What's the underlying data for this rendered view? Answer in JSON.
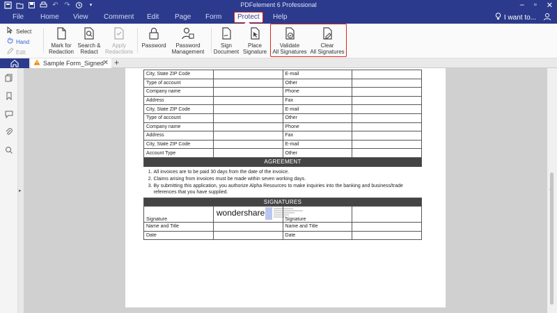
{
  "app": {
    "title": "PDFelement 6 Professional",
    "tell_me": "I want to..."
  },
  "menu": {
    "tabs": [
      "File",
      "Home",
      "View",
      "Comment",
      "Edit",
      "Page",
      "Form",
      "Protect",
      "Help"
    ],
    "active": "Protect"
  },
  "ribbon": {
    "tools": [
      {
        "label": "Select",
        "state": "normal"
      },
      {
        "label": "Hand",
        "state": "active"
      },
      {
        "label": "Edit",
        "state": "disabled"
      }
    ],
    "buttons": [
      {
        "l1": "Mark for",
        "l2": "Redaction",
        "icon": "redaction-mark-icon",
        "disabled": false
      },
      {
        "l1": "Search &",
        "l2": "Redact",
        "icon": "search-redact-icon",
        "disabled": false
      },
      {
        "l1": "Apply",
        "l2": "Redactions",
        "icon": "apply-redactions-icon",
        "disabled": true
      },
      {
        "l1": "Password",
        "l2": "",
        "icon": "lock-icon",
        "disabled": false
      },
      {
        "l1": "Password",
        "l2": "Management",
        "icon": "password-management-icon",
        "disabled": false
      },
      {
        "l1": "Sign",
        "l2": "Document",
        "icon": "sign-document-icon",
        "disabled": false
      },
      {
        "l1": "Place",
        "l2": "Signature",
        "icon": "place-signature-icon",
        "disabled": false
      },
      {
        "l1": "Validate",
        "l2": "All Signatures",
        "icon": "validate-signatures-icon",
        "disabled": false
      },
      {
        "l1": "Clear",
        "l2": "All Signatures",
        "icon": "clear-signatures-icon",
        "disabled": false
      }
    ]
  },
  "document": {
    "tab_name": "Sample Form_Signed"
  },
  "form": {
    "rows": [
      [
        "City, State ZIP Code",
        "",
        "E-mail",
        ""
      ],
      [
        "Type of account",
        "",
        "Other",
        ""
      ],
      [
        "Company name",
        "",
        "Phone",
        ""
      ],
      [
        "Address",
        "",
        "Fax",
        ""
      ],
      [
        "City, State ZIP Code",
        "",
        "E-mail",
        ""
      ],
      [
        "Type of account",
        "",
        "Other",
        ""
      ],
      [
        "Company name",
        "",
        "Phone",
        ""
      ],
      [
        "Address",
        "",
        "Fax",
        ""
      ],
      [
        "City, State ZIP Code",
        "",
        "E-mail",
        ""
      ],
      [
        "Account Type",
        "",
        "Other",
        ""
      ]
    ],
    "agreement_header": "AGREEMENT",
    "agreement_items": [
      "All invoices are to be paid 30 days from the date of the invoice.",
      "Claims arising from invoices must be made within seven working days.",
      "By submitting this application, you authorize Alpha Resources to make inquiries into the banking and business/trade references that you have supplied."
    ],
    "signatures_header": "SIGNATURES",
    "sig_rows": [
      [
        "Signature",
        "",
        "Signature",
        ""
      ],
      [
        "Name and Title",
        "",
        "Name and Title",
        ""
      ],
      [
        "Date",
        "",
        "Date",
        ""
      ]
    ],
    "sig_brand": "wondershare"
  }
}
